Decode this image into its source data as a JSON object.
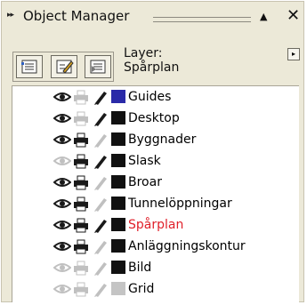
{
  "panel": {
    "grip": "▸▸",
    "title": "Object Manager",
    "collapse_glyph": "▲",
    "close_glyph": "✕"
  },
  "toolbar": {
    "buttons": [
      {
        "icon": "show-object-properties-icon"
      },
      {
        "icon": "edit-across-layers-icon"
      },
      {
        "icon": "layer-manager-view-icon"
      }
    ]
  },
  "layer_info": {
    "label": "Layer:",
    "current": "Spårplan"
  },
  "flyout_glyph": "▸",
  "colors": {
    "active_layer_text": "#e0202a",
    "enabled_icon": "#1a1a1a",
    "disabled_icon": "#c0c0c0"
  },
  "layers": [
    {
      "name": "Guides",
      "color": "#2a2aa8",
      "visible": true,
      "printable": false,
      "editable": true,
      "active": false
    },
    {
      "name": "Desktop",
      "color": "#111111",
      "visible": true,
      "printable": false,
      "editable": true,
      "active": false
    },
    {
      "name": "Byggnader",
      "color": "#111111",
      "visible": true,
      "printable": true,
      "editable": false,
      "active": false
    },
    {
      "name": "Slask",
      "color": "#111111",
      "visible": false,
      "printable": true,
      "editable": true,
      "active": false
    },
    {
      "name": "Broar",
      "color": "#111111",
      "visible": true,
      "printable": true,
      "editable": false,
      "active": false
    },
    {
      "name": "Tunnelöppningar",
      "color": "#111111",
      "visible": true,
      "printable": true,
      "editable": false,
      "active": false
    },
    {
      "name": "Spårplan",
      "color": "#111111",
      "visible": true,
      "printable": true,
      "editable": true,
      "active": true
    },
    {
      "name": "Anläggningskontur",
      "color": "#111111",
      "visible": true,
      "printable": true,
      "editable": false,
      "active": false
    },
    {
      "name": "Bild",
      "color": "#111111",
      "visible": false,
      "printable": false,
      "editable": false,
      "active": false
    },
    {
      "name": "Grid",
      "color": "#c4c4c4",
      "visible": false,
      "printable": false,
      "editable": false,
      "active": false
    }
  ]
}
